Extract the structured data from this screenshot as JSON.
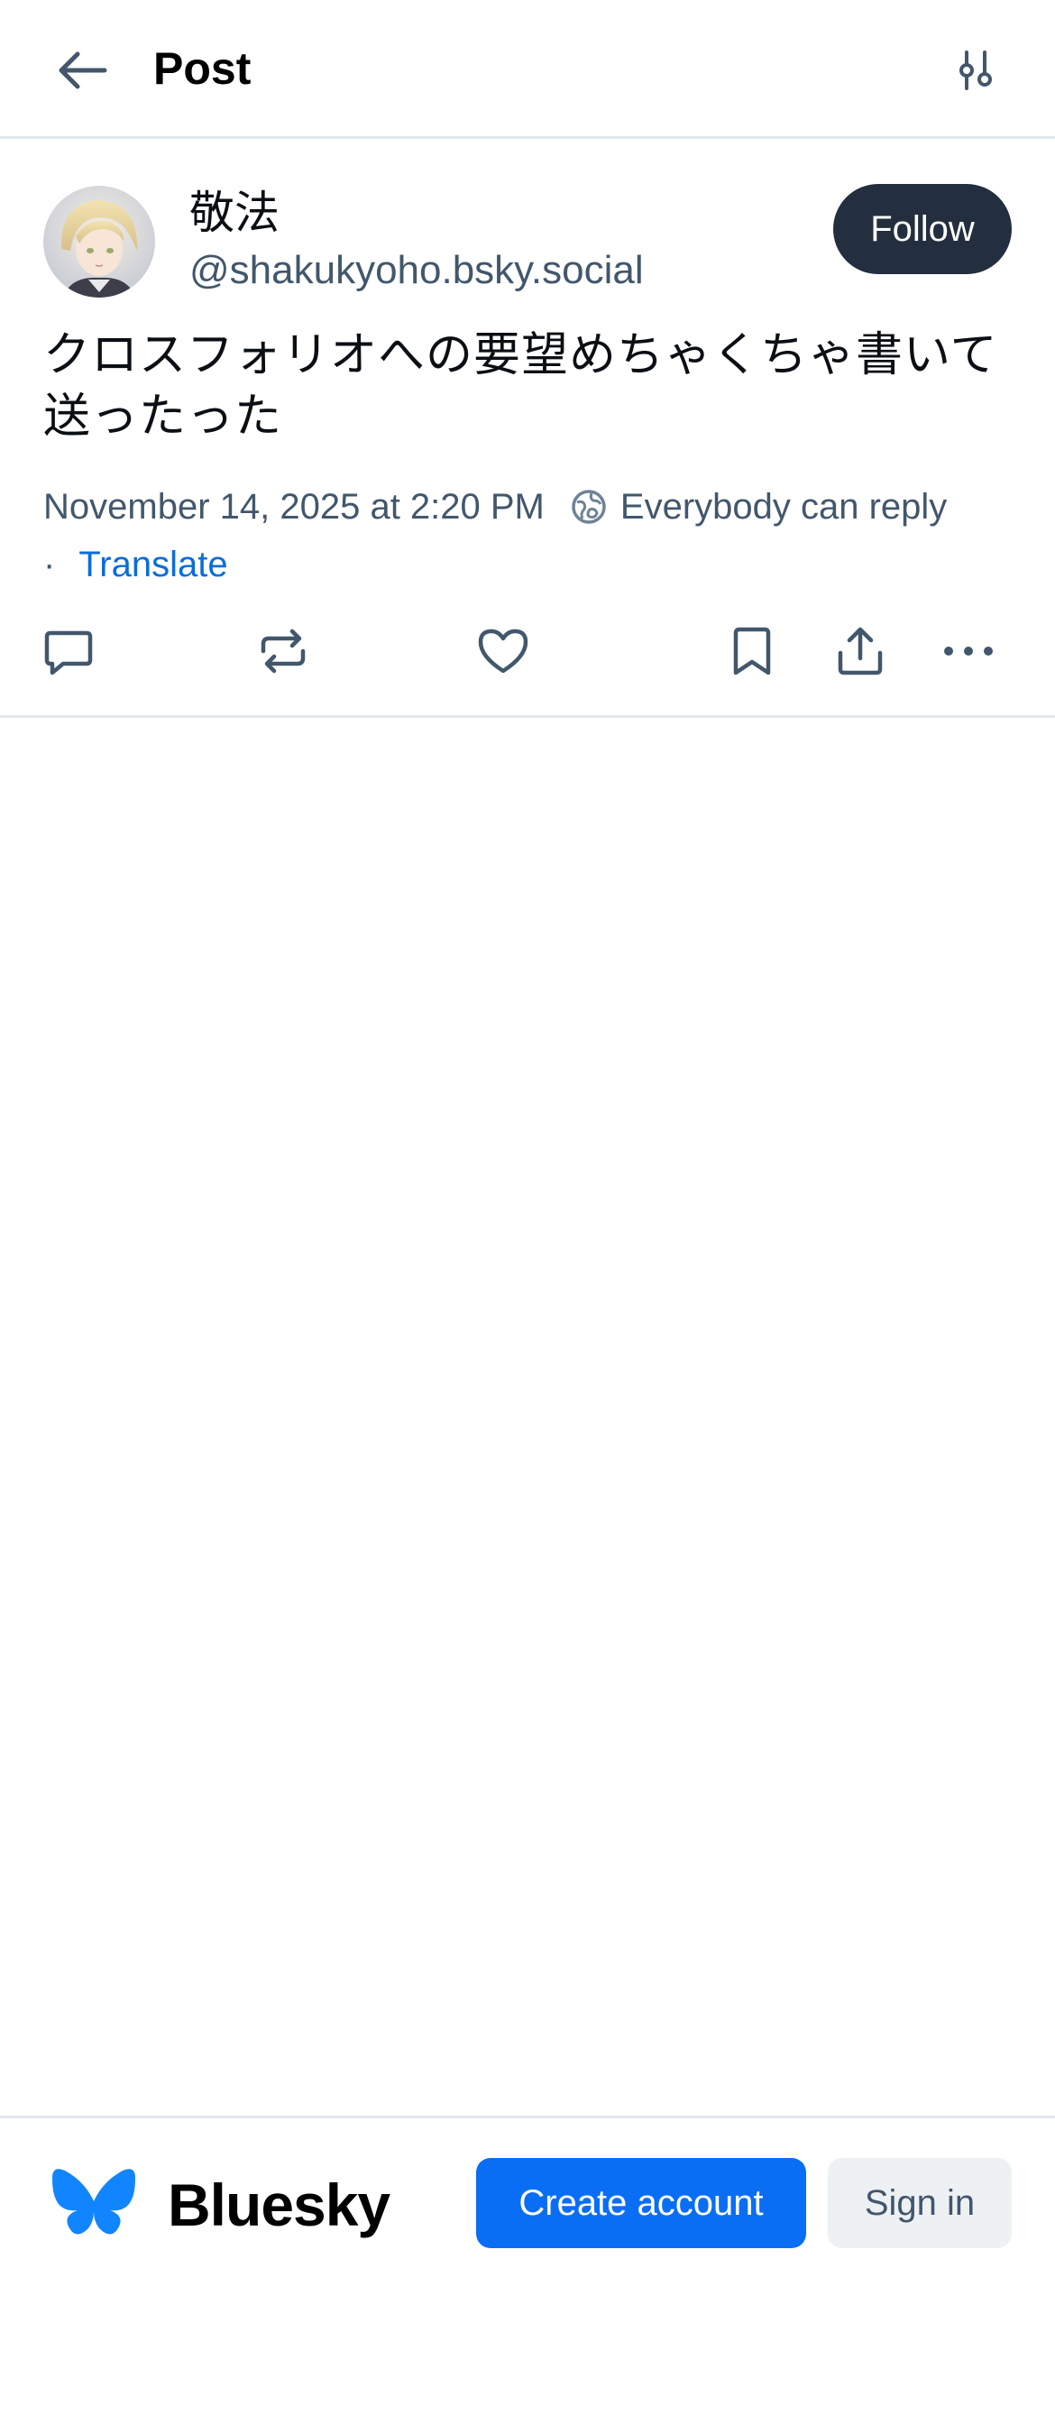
{
  "header": {
    "title": "Post",
    "back_icon": "arrow-left-icon",
    "filter_icon": "sliders-icon"
  },
  "post": {
    "display_name": "敬法",
    "handle": "@shakukyoho.bsky.social",
    "follow_label": "Follow",
    "text": "クロスフォリオへの要望めちゃくちゃ書いて送ったった",
    "timestamp": "November 14, 2025 at 2:20 PM",
    "reply_setting": "Everybody can reply",
    "separator": "·",
    "translate_label": "Translate",
    "actions": [
      "reply-icon",
      "repost-icon",
      "like-icon",
      "bookmark-icon",
      "share-icon",
      "more-icon"
    ]
  },
  "footer": {
    "brand_name": "Bluesky",
    "create_account_label": "Create account",
    "sign_in_label": "Sign in"
  },
  "colors": {
    "accent": "#0a6ef5",
    "link": "#0a6dd9",
    "follow_bg": "#232e3e",
    "muted_text": "#42576c",
    "divider": "#e3e7ec"
  }
}
